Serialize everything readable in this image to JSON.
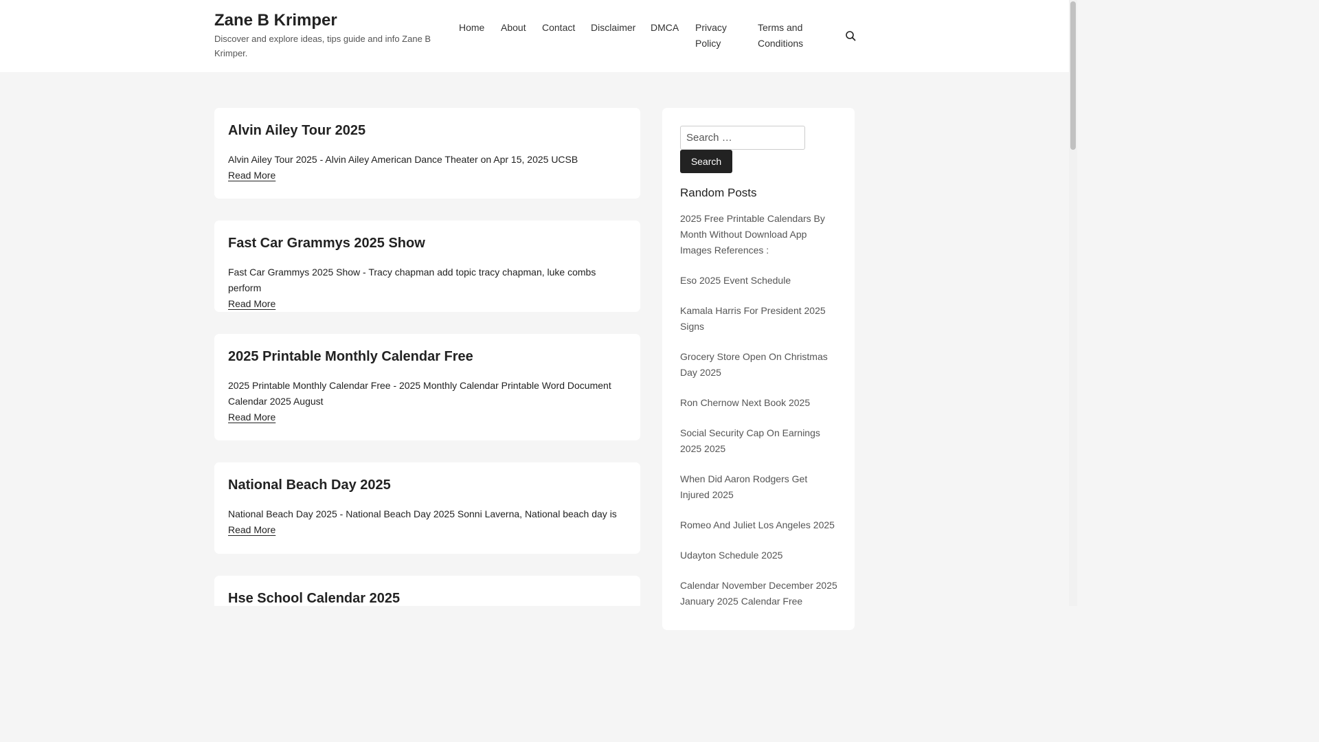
{
  "site": {
    "title": "Zane B Krimper",
    "description": "Discover and explore ideas, tips guide and info Zane B Krimper."
  },
  "nav": {
    "items": [
      {
        "label": "Home"
      },
      {
        "label": "About"
      },
      {
        "label": "Contact"
      },
      {
        "label": "Disclaimer"
      },
      {
        "label": "DMCA"
      },
      {
        "label": "Privacy Policy"
      },
      {
        "label": "Terms and Conditions"
      }
    ],
    "search_icon": "search-icon"
  },
  "posts": [
    {
      "title": "Alvin Ailey Tour 2025",
      "excerpt": "Alvin Ailey Tour 2025 - Alvin Ailey American Dance Theater on Apr 15, 2025 UCSB",
      "read_more": "Read More"
    },
    {
      "title": "Fast Car Grammys 2025 Show",
      "excerpt": "Fast Car Grammys 2025 Show - Tracy chapman add topic tracy chapman, luke combs perform",
      "read_more": "Read More"
    },
    {
      "title": "2025 Printable Monthly Calendar Free",
      "excerpt": "2025 Printable Monthly Calendar Free - 2025 Monthly Calendar Printable Word Document Calendar 2025 August",
      "read_more": "Read More"
    },
    {
      "title": "National Beach Day 2025",
      "excerpt": "National Beach Day 2025 - National Beach Day 2025 Sonni Laverna, National beach day is",
      "read_more": "Read More"
    },
    {
      "title": "Hse School Calendar 2025",
      "excerpt": "",
      "read_more": ""
    }
  ],
  "sidebar": {
    "search": {
      "placeholder": "Search …",
      "button_label": "Search"
    },
    "random_posts": {
      "title": "Random Posts",
      "items": [
        "2025 Free Printable Calendars By Month Without Download App Images References :",
        "Eso 2025 Event Schedule",
        "Kamala Harris For President 2025 Signs",
        "Grocery Store Open On Christmas Day 2025",
        "Ron Chernow Next Book 2025",
        "Social Security Cap On Earnings 2025 2025",
        "When Did Aaron Rodgers Get Injured 2025",
        "Romeo And Juliet Los Angeles 2025",
        "Udayton Schedule 2025",
        "Calendar November December 2025 January 2025 Calendar Free"
      ]
    }
  },
  "colors": {
    "page_bg": "#f5f5f5",
    "card_bg": "#ffffff",
    "text": "#222222",
    "muted": "#555555",
    "button_bg": "#222222"
  }
}
